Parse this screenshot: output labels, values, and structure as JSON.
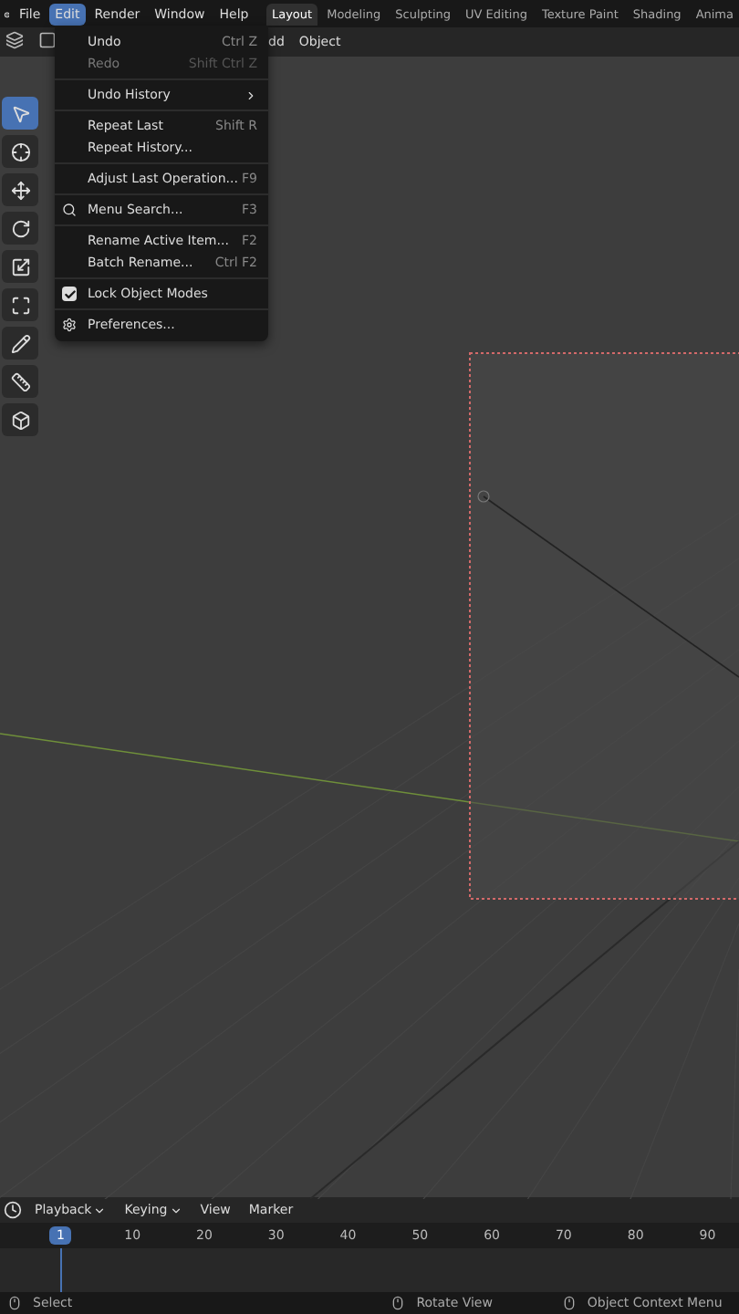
{
  "menubar": [
    {
      "label": "File",
      "selected": false
    },
    {
      "label": "Edit",
      "selected": true
    },
    {
      "label": "Render",
      "selected": false
    },
    {
      "label": "Window",
      "selected": false
    },
    {
      "label": "Help",
      "selected": false
    }
  ],
  "workspaces": [
    {
      "label": "Layout",
      "selected": true
    },
    {
      "label": "Modeling",
      "selected": false
    },
    {
      "label": "Sculpting",
      "selected": false
    },
    {
      "label": "UV Editing",
      "selected": false
    },
    {
      "label": "Texture Paint",
      "selected": false
    },
    {
      "label": "Shading",
      "selected": false
    },
    {
      "label": "Anima",
      "selected": false
    }
  ],
  "viewport_header": [
    "dd",
    "Object"
  ],
  "tools": [
    {
      "kind": "select",
      "selected": true
    },
    {
      "kind": "cursor",
      "selected": false
    },
    {
      "kind": "move",
      "selected": false
    },
    {
      "kind": "rotate",
      "selected": false
    },
    {
      "kind": "scale",
      "selected": false
    },
    {
      "kind": "transform",
      "selected": false
    },
    {
      "kind": "annotate",
      "selected": false
    },
    {
      "kind": "measure",
      "selected": false
    },
    {
      "kind": "add",
      "selected": false
    }
  ],
  "edit_menu": [
    {
      "kind": "item",
      "label": "Undo",
      "shortcut": "Ctrl Z",
      "disabled": false
    },
    {
      "kind": "item",
      "label": "Redo",
      "shortcut": "Shift Ctrl Z",
      "disabled": true
    },
    {
      "kind": "separator"
    },
    {
      "kind": "submenu",
      "label": "Undo History",
      "disabled": false
    },
    {
      "kind": "separator"
    },
    {
      "kind": "item",
      "label": "Repeat Last",
      "shortcut": "Shift R",
      "disabled": false
    },
    {
      "kind": "item",
      "label": "Repeat History...",
      "disabled": false
    },
    {
      "kind": "separator"
    },
    {
      "kind": "item",
      "label": "Adjust Last Operation...",
      "shortcut": "F9",
      "disabled": false
    },
    {
      "kind": "separator"
    },
    {
      "kind": "search",
      "label": "Menu Search...",
      "shortcut": "F3",
      "disabled": false
    },
    {
      "kind": "separator"
    },
    {
      "kind": "item",
      "label": "Rename Active Item...",
      "shortcut": "F2",
      "disabled": false
    },
    {
      "kind": "item",
      "label": "Batch Rename...",
      "shortcut": "Ctrl F2",
      "disabled": false
    },
    {
      "kind": "separator"
    },
    {
      "kind": "checkbox",
      "label": "Lock Object Modes",
      "checked": true,
      "disabled": false
    },
    {
      "kind": "separator"
    },
    {
      "kind": "settings",
      "label": "Preferences...",
      "disabled": false
    }
  ],
  "timeline": {
    "menus": [
      {
        "label": "Playback",
        "dropdown": true
      },
      {
        "label": "Keying",
        "dropdown": true
      },
      {
        "label": "View",
        "dropdown": false
      },
      {
        "label": "Marker",
        "dropdown": false
      }
    ],
    "frames": [
      {
        "label": "1",
        "selected": true
      },
      {
        "label": "10",
        "selected": false
      },
      {
        "label": "20",
        "selected": false
      },
      {
        "label": "30",
        "selected": false
      },
      {
        "label": "40",
        "selected": false
      },
      {
        "label": "50",
        "selected": false
      },
      {
        "label": "60",
        "selected": false
      },
      {
        "label": "70",
        "selected": false
      },
      {
        "label": "80",
        "selected": false
      },
      {
        "label": "90",
        "selected": false
      }
    ]
  },
  "status_bar": [
    {
      "kind": "left",
      "label": "Select"
    },
    {
      "kind": "middle",
      "label": "Rotate View"
    },
    {
      "kind": "right",
      "label": "Object Context Menu"
    }
  ]
}
